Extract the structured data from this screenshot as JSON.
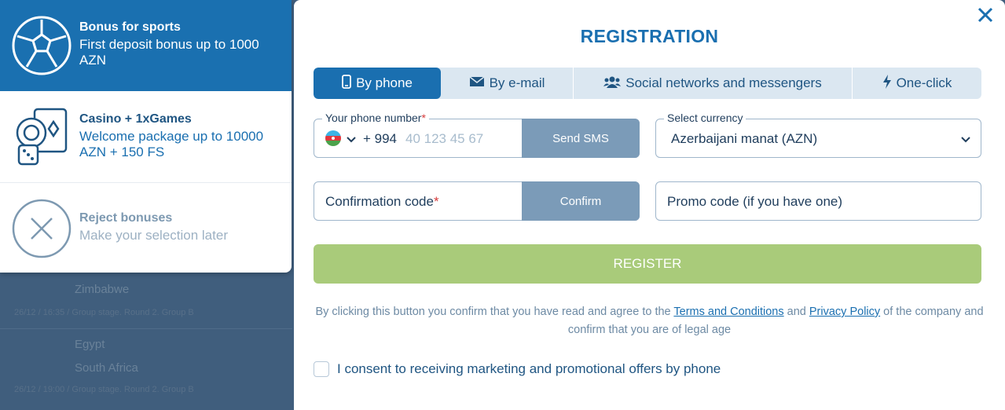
{
  "background": {
    "rows": [
      "Zimbabwe",
      "26/12 / 16:35 / Group stage. Round 2. Group B",
      "Egypt",
      "South Africa",
      "26/12 / 19:00 / Group stage. Round 2. Group B"
    ]
  },
  "bonuses": {
    "sports": {
      "title": "Bonus for sports",
      "desc": "First deposit bonus up to 1000 AZN",
      "icon": "soccer-ball-icon"
    },
    "casino": {
      "title": "Casino + 1xGames",
      "desc": "Welcome package up to 10000 AZN + 150 FS",
      "icon": "casino-chips-cards-icon"
    },
    "reject": {
      "title": "Reject bonuses",
      "desc": "Make your selection later",
      "icon": "reject-x-icon"
    }
  },
  "registration": {
    "title": "REGISTRATION",
    "tabs": [
      {
        "label": "By phone",
        "icon": "phone-icon",
        "active": true
      },
      {
        "label": "By e-mail",
        "icon": "envelope-icon"
      },
      {
        "label": "Social networks and messengers",
        "icon": "people-icon"
      },
      {
        "label": "One-click",
        "icon": "lightning-icon"
      }
    ],
    "phone": {
      "label": "Your phone number",
      "required_mark": "*",
      "prefix": "+ 994",
      "placeholder": "40 123 45 67",
      "send_sms": "Send SMS"
    },
    "currency": {
      "label": "Select currency",
      "value": "Azerbaijani manat (AZN)"
    },
    "confirmation": {
      "label": "Confirmation code",
      "required_mark": "*",
      "confirm_btn": "Confirm"
    },
    "promo": {
      "placeholder": "Promo code (if you have one)"
    },
    "register_btn": "REGISTER",
    "legal": {
      "text_1": "By clicking this button you confirm that you have read and agree to the ",
      "terms_link": "Terms and Conditions",
      "and": " and ",
      "privacy_link": "Privacy Policy",
      "text_2": " of the company and confirm that you are of legal age"
    },
    "consent": "I consent to receiving marketing and promotional offers by phone"
  },
  "colors": {
    "primary": "#1a6fb0",
    "register": "#a9cb7a",
    "button_gray": "#7b9bb8"
  }
}
